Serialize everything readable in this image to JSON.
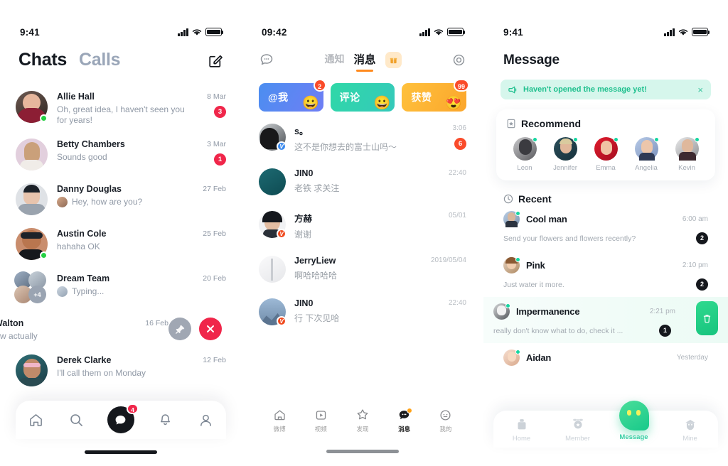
{
  "panel_chats": {
    "statusbar": {
      "time": "9:41"
    },
    "tabs": {
      "active": "Chats",
      "inactive": "Calls"
    },
    "compose_icon": "compose-icon",
    "rows": [
      {
        "name": "Allie Hall",
        "message": "Oh, great idea, I haven't seen you for years!",
        "date": "8 Mar",
        "badge": "3",
        "online": true,
        "has_mini": false
      },
      {
        "name": "Betty Chambers",
        "message": "Sounds good",
        "date": "3 Mar",
        "badge": "1",
        "online": false,
        "has_mini": false
      },
      {
        "name": "Danny Douglas",
        "message": "Hey, how are you?",
        "date": "27 Feb",
        "badge": "",
        "online": false,
        "has_mini": true
      },
      {
        "name": "Austin Cole",
        "message": "hahaha OK",
        "date": "25 Feb",
        "badge": "",
        "online": true,
        "has_mini": false
      },
      {
        "name": "Dream Team",
        "message": "Typing...",
        "date": "20 Feb",
        "badge": "",
        "online": false,
        "has_mini": true,
        "group": true,
        "group_more": "+4"
      },
      {
        "name": "ne Walton",
        "message": "t know actually",
        "date": "16 Feb",
        "badge": "",
        "swiped": true,
        "pin_icon": "pin-icon",
        "delete_icon": "close-icon"
      },
      {
        "name": "Derek Clarke",
        "message": "I'll call them on Monday",
        "date": "12 Feb",
        "badge": "",
        "online": false,
        "has_mini": false
      }
    ],
    "tabbar": [
      {
        "icon": "home-icon",
        "active": false,
        "badge": ""
      },
      {
        "icon": "search-icon",
        "active": false,
        "badge": ""
      },
      {
        "icon": "chat-icon",
        "active": true,
        "badge": "4"
      },
      {
        "icon": "bell-icon",
        "active": false,
        "badge": ""
      },
      {
        "icon": "person-icon",
        "active": false,
        "badge": ""
      }
    ]
  },
  "panel_weibo": {
    "statusbar": {
      "time": "09:42"
    },
    "header": {
      "left_icon": "chat-bubble-icon",
      "right_icon": "settings-gear-icon",
      "tab_inactive": "通知",
      "tab_active": "消息",
      "chip_icon": "gift-icon"
    },
    "cards": [
      {
        "label": "@我",
        "badge": "2",
        "emoji": "😀",
        "color": "#4b8ef0"
      },
      {
        "label": "评论",
        "badge": "",
        "emoji": "😀",
        "color": "#2fd8a7"
      },
      {
        "label": "获赞",
        "badge": "99",
        "emoji": "😍",
        "color": "#ffc13c"
      }
    ],
    "rows": [
      {
        "name": "s。",
        "message": "这不是你想去的富士山吗～",
        "time": "3:06",
        "badge": "6",
        "verified": "blue"
      },
      {
        "name": "JIN0",
        "message": "老铁 求关注",
        "time": "22:40",
        "badge": "",
        "verified": ""
      },
      {
        "name": "方赫",
        "message": "谢谢",
        "time": "05/01",
        "badge": "",
        "verified": "red"
      },
      {
        "name": "JerryLiew",
        "message": "啊哈哈哈哈",
        "time": "2019/05/04",
        "badge": "",
        "verified": ""
      },
      {
        "name": "JIN0",
        "message": "行 下次见哈",
        "time": "22:40",
        "badge": "",
        "verified": "red"
      }
    ],
    "tabbar": [
      {
        "label": "微博",
        "icon": "home-icon",
        "active": false,
        "badge": false
      },
      {
        "label": "视频",
        "icon": "video-icon",
        "active": false,
        "badge": false
      },
      {
        "label": "发现",
        "icon": "star-icon",
        "active": false,
        "badge": false
      },
      {
        "label": "消息",
        "icon": "chat-icon",
        "active": true,
        "badge": true
      },
      {
        "label": "我的",
        "icon": "face-icon",
        "active": false,
        "badge": false
      }
    ]
  },
  "panel_message": {
    "statusbar": {
      "time": "9:41"
    },
    "title": "Message",
    "banner": {
      "icon": "megaphone-icon",
      "text": "Haven't opened the message yet!",
      "close": "×"
    },
    "recommend": {
      "title": "Recommend",
      "icon": "bookmark-star-icon",
      "people": [
        {
          "name": "Leon"
        },
        {
          "name": "Jennifer"
        },
        {
          "name": "Emma"
        },
        {
          "name": "Angelia"
        },
        {
          "name": "Kevin"
        }
      ]
    },
    "recent": {
      "title": "Recent",
      "icon": "clock-icon",
      "rows": [
        {
          "name": "Cool man",
          "time": "6:00 am",
          "message": "Send your flowers and flowers recently?",
          "badge": "2",
          "swiped": false
        },
        {
          "name": "Pink",
          "time": "2:10 pm",
          "message": "Just water it more.",
          "badge": "2",
          "swiped": false
        },
        {
          "name": "Impermanence",
          "time": "2:21 pm",
          "message": "really don't know what to do, check it ...",
          "badge": "1",
          "swiped": true,
          "trash_icon": "trash-icon"
        },
        {
          "name": "Aidan",
          "time": "Yesterday",
          "message": "",
          "badge": "",
          "swiped": false
        }
      ]
    },
    "tabbar": [
      {
        "label": "Home",
        "icon": "home-icon",
        "active": false
      },
      {
        "label": "Member",
        "icon": "member-icon",
        "active": false
      },
      {
        "label": "Message",
        "icon": "message-bubble-icon",
        "active": true
      },
      {
        "label": "Mine",
        "icon": "mine-icon",
        "active": false
      }
    ]
  },
  "colors": {
    "red_badge": "#f0264a",
    "orange_badge": "#fa4b2a",
    "teal_accent": "#1fc08e",
    "banner_bg": "#d6f6ec",
    "online_green": "#25d043",
    "dark": "#15181d"
  }
}
